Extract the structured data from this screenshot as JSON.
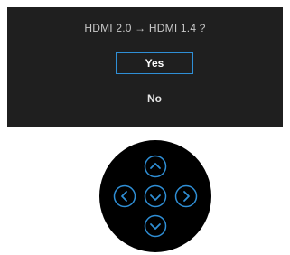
{
  "dialog": {
    "prompt": "HDMI 2.0 → HDMI 1.4 ?",
    "options": [
      {
        "label": "Yes",
        "selected": true
      },
      {
        "label": "No",
        "selected": false
      }
    ]
  },
  "joystick": {
    "buttons": [
      "up-icon",
      "left-icon",
      "confirm-icon",
      "right-icon",
      "down-icon"
    ],
    "accent_color": "#2f8fd6"
  },
  "colors": {
    "osd_background": "#1f1f1f",
    "selection_border": "#2f8fd6"
  }
}
